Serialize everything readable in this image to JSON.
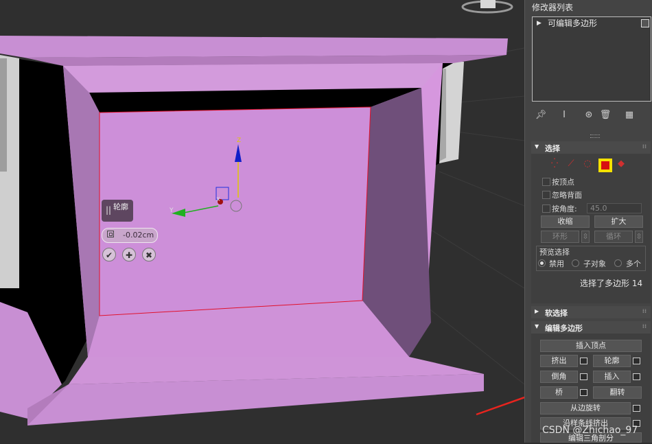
{
  "viewport": {
    "caddy": {
      "title": "轮廓",
      "value": "-0.02cm",
      "ok": "✔",
      "apply": "✚",
      "cancel": "✖"
    },
    "gizmo": {
      "z_label": "Z",
      "y_label": "Y",
      "x_label": "X"
    }
  },
  "panel": {
    "modifier_list_label": "修改器列表",
    "stack_items": [
      {
        "label": "可编辑多边形"
      }
    ],
    "toolbar_icons": [
      "pin-stack-icon",
      "show-end-result-icon",
      "make-unique-icon",
      "remove-modifier-icon",
      "configure-modifier-sets-icon"
    ],
    "selection": {
      "title": "选择",
      "levels": [
        "vertex-level-icon",
        "edge-level-icon",
        "border-level-icon",
        "polygon-level-icon",
        "element-level-icon"
      ],
      "active_level": "polygon-level-icon",
      "by_vertex": "按顶点",
      "ignore_backfacing": "忽略背面",
      "by_angle": "按角度:",
      "angle_value": "45.0",
      "shrink": "收缩",
      "grow": "扩大",
      "ring": "环形",
      "loop": "循环",
      "preview_label": "预览选择",
      "preview_options": [
        {
          "label": "禁用",
          "checked": true
        },
        {
          "label": "子对象",
          "checked": false
        },
        {
          "label": "多个",
          "checked": false
        }
      ],
      "status": "选择了多边形 14"
    },
    "soft_selection": {
      "title": "软选择"
    },
    "edit_polygons": {
      "title": "编辑多边形",
      "insert_vertex": "插入顶点",
      "extrude": "挤出",
      "outline": "轮廓",
      "bevel": "倒角",
      "inset": "插入",
      "bridge": "桥",
      "flip": "翻转",
      "hinge_from_edge": "从边旋转",
      "extrude_along_spline": "沿样条线挤出",
      "edit_triangulation": "编辑三角剖分"
    }
  },
  "watermark": "CSDN @Zhichao_97",
  "colors": {
    "object": "#cc8fd6",
    "highlight": "#f5e100",
    "selection_red": "#d81010",
    "arrow": "#e8241e"
  }
}
